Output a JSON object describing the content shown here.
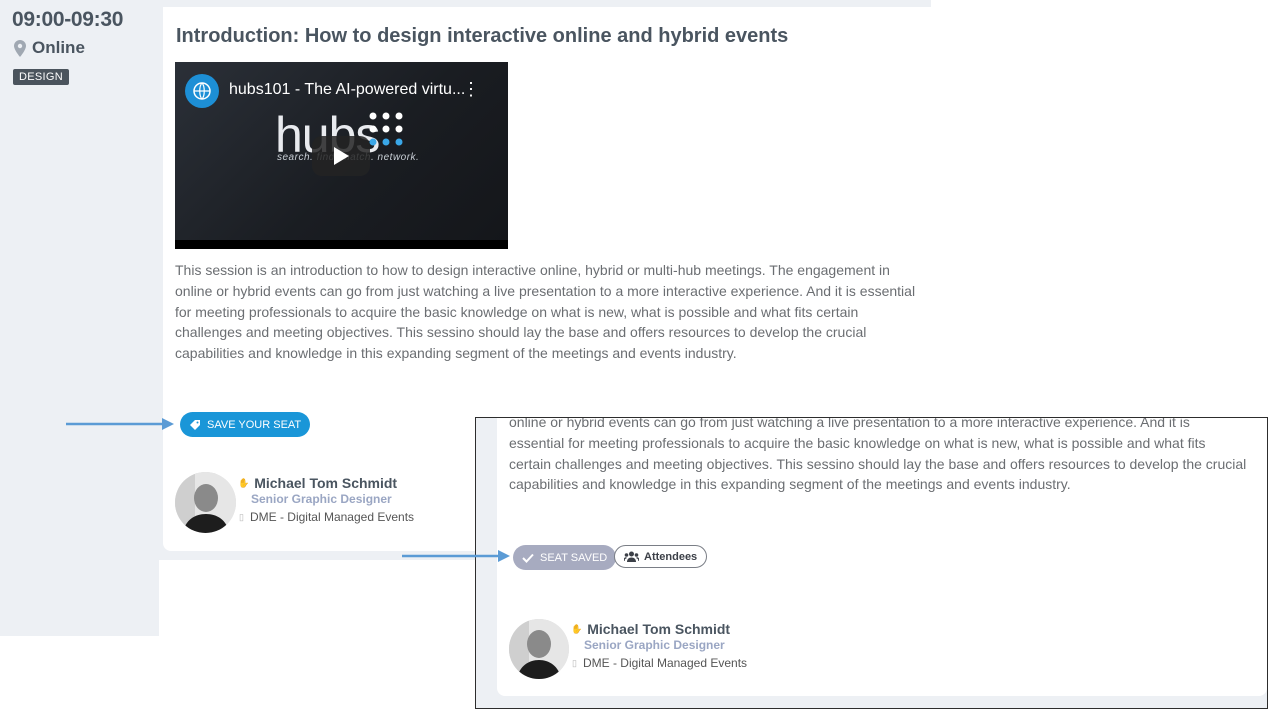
{
  "session": {
    "time": "09:00-09:30",
    "location": "Online",
    "tag": "DESIGN",
    "title": "Introduction: How to design interactive online and hybrid events",
    "description": "This session is an introduction to how to design interactive online, hybrid or multi-hub meetings. The engagement in online or hybrid events can go from just watching a live presentation to a more interactive experience. And it is essential for meeting professionals to acquire the basic knowledge on what is new, what is possible and what fits certain challenges and meeting objectives. This sessino should lay the base and offers resources to develop the crucial capabilities and knowledge in this expanding segment of the meetings and events industry."
  },
  "video": {
    "title": "hubs101 - The AI-powered virtu...",
    "logo_word": "hubs",
    "tagline": "search. find. match. network."
  },
  "actions": {
    "save_seat_label": "SAVE YOUR SEAT",
    "seat_saved_label": "SEAT SAVED",
    "attendees_label": "Attendees"
  },
  "speaker": {
    "name": "Michael Tom Schmidt",
    "role": "Senior Graphic Designer",
    "org": "DME - Digital Managed Events"
  },
  "inset": {
    "description": "online or hybrid events can go from just watching a live presentation to a more interactive experience. And it is essential for meeting professionals to acquire the basic knowledge on what is new, what is possible and what fits certain challenges and meeting objectives. This sessino should lay the base and offers resources to develop the crucial capabilities and knowledge in this expanding segment of the meetings and events industry."
  },
  "colors": {
    "accent": "#1a96d8",
    "seat_saved_bg": "#a7abc0",
    "annotation_arrow": "#5b9bd5"
  }
}
